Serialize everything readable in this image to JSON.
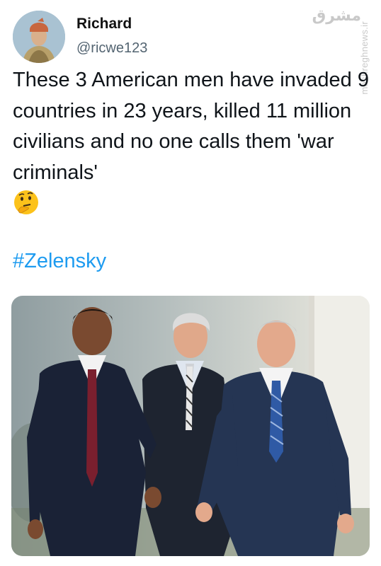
{
  "user": {
    "display_name": "Richard",
    "handle": "@ricwe123"
  },
  "watermark": {
    "logo": "ﻣﺸﺮﻕ",
    "site": "mashreghnews.ir"
  },
  "tweet": {
    "text": "These 3 American men have invaded 9 countries in 23 years, killed 11 million civilians and no one calls them 'war criminals'",
    "emoji": "thinking-face",
    "hashtag": "#Zelensky"
  },
  "colors": {
    "hashtag": "#1d9bf0",
    "handle": "#536471"
  }
}
